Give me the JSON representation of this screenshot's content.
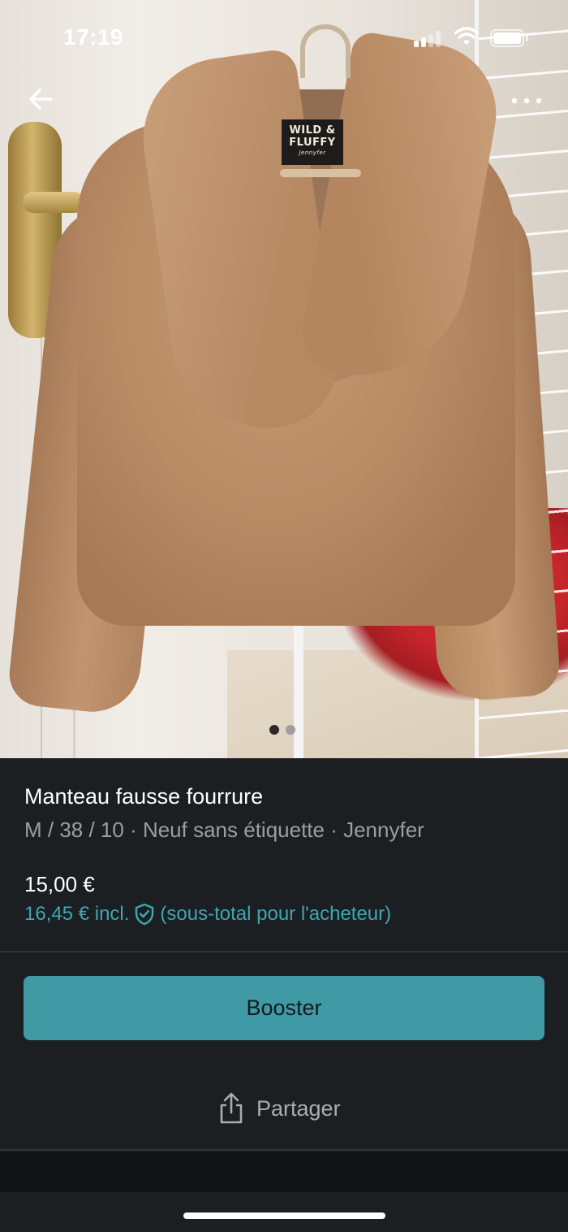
{
  "status_bar": {
    "time": "17:19"
  },
  "header": {
    "back_icon": "arrow-left-icon",
    "more_icon": "more-horizontal-icon"
  },
  "photo": {
    "brand_tag_line1": "WILD &",
    "brand_tag_line2": "FLUFFY",
    "brand_tag_sub": "Jennyfer",
    "page_count": 2,
    "current_page": 1
  },
  "item": {
    "title": "Manteau fausse fourrure",
    "subtitle": "M / 38 / 10 · Neuf sans étiquette · Jennyfer",
    "price": "15,00 €",
    "price_incl_prefix": "16,45 € incl.",
    "price_incl_suffix": "(sous-total pour l'acheteur)"
  },
  "actions": {
    "boost_label": "Booster",
    "share_label": "Partager",
    "share_icon": "share-icon"
  },
  "colors": {
    "background": "#1b1f21",
    "accent": "#3f9aa6",
    "accent_text": "#3fa6b2",
    "muted_text": "#9a9fa2"
  }
}
